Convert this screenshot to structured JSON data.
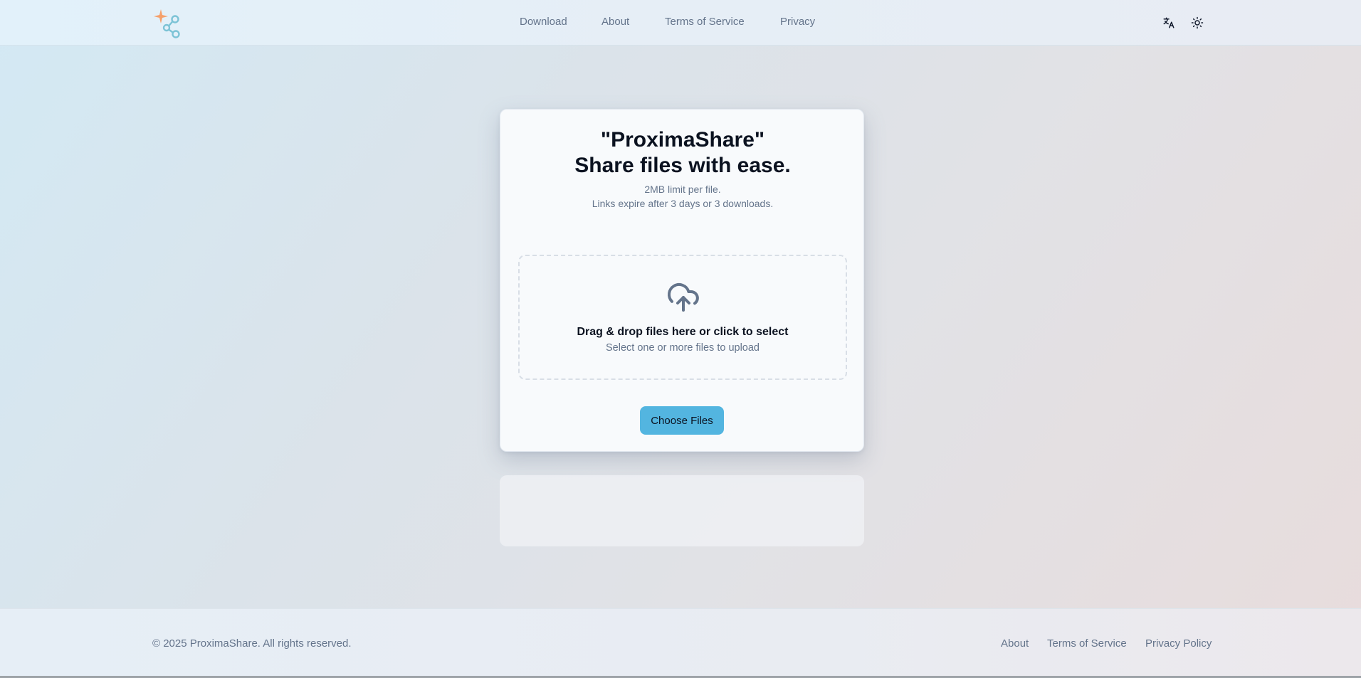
{
  "header": {
    "nav": {
      "download": "Download",
      "about": "About",
      "terms": "Terms of Service",
      "privacy": "Privacy"
    },
    "icons": {
      "logo": "share-nodes-sparkle-logo",
      "language": "translate-icon",
      "theme": "sun-icon"
    }
  },
  "hero": {
    "title_line1": "\"ProximaShare\"",
    "title_line2": "Share files with ease.",
    "limit": "2MB limit per file.",
    "expiry": "Links expire after 3 days or 3 downloads."
  },
  "dropzone": {
    "icon": "cloud-upload-icon",
    "title": "Drag & drop files here or click to select",
    "subtitle": "Select one or more files to upload"
  },
  "actions": {
    "choose_files": "Choose Files"
  },
  "footer": {
    "copyright": "© 2025 ProximaShare. All rights reserved.",
    "links": {
      "about": "About",
      "terms": "Terms of Service",
      "privacy_policy": "Privacy Policy"
    }
  },
  "colors": {
    "accent": "#53b5e0",
    "logo_sparkle": "#f5a06b",
    "logo_nodes": "#7cc3d6",
    "muted_text": "#64748b",
    "heading_text": "#0b1220"
  }
}
